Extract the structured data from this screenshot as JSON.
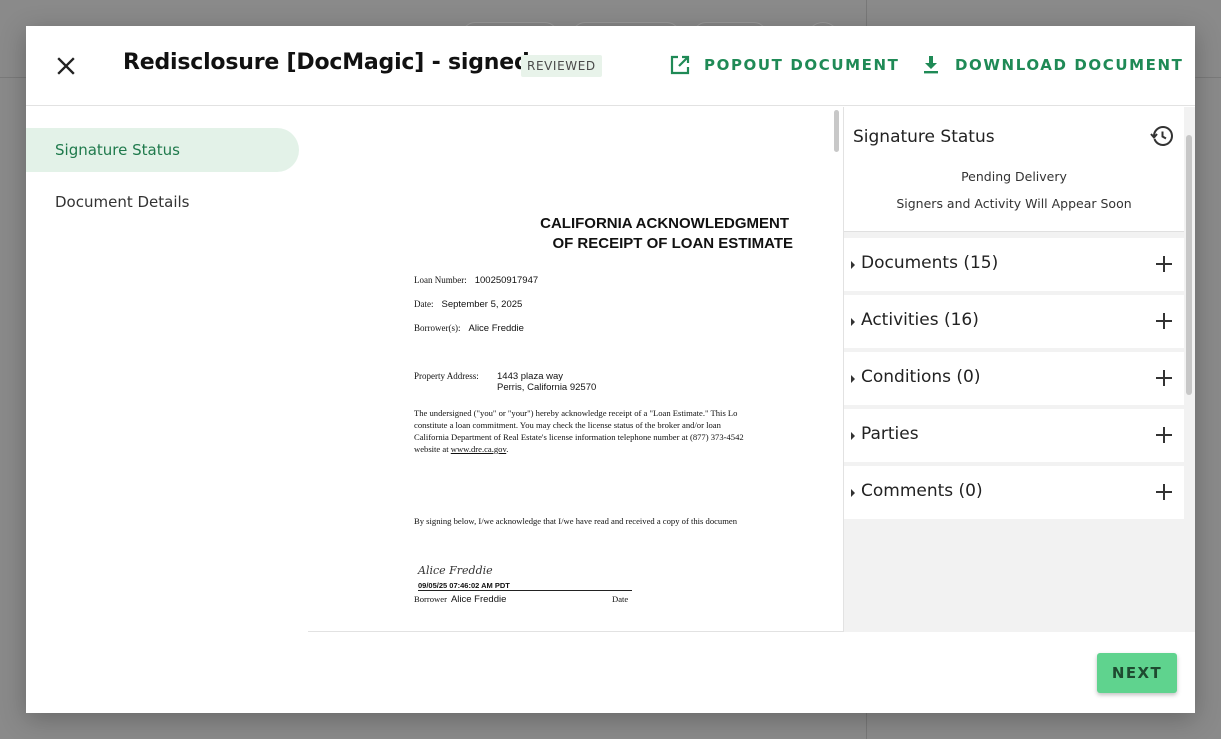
{
  "header": {
    "title": "Redisclosure [DocMagic] - signed",
    "badge": "REVIEWED",
    "popout_label": "POPOUT DOCUMENT",
    "download_label": "DOWNLOAD DOCUMENT",
    "icons": {
      "close": "close-icon",
      "popout": "open-in-new-icon",
      "download": "download-icon"
    }
  },
  "left_nav": {
    "items": [
      {
        "label": "Signature Status",
        "active": true
      },
      {
        "label": "Document Details",
        "active": false
      }
    ]
  },
  "document": {
    "title_line1": "CALIFORNIA ACKNOWLEDGMENT",
    "title_line2": "OF RECEIPT OF LOAN ESTIMATE",
    "loan_number_label": "Loan Number:",
    "loan_number": "100250917947",
    "date_label": "Date:",
    "date": "September 5, 2025",
    "borrowers_label": "Borrower(s):",
    "borrowers": "Alice Freddie",
    "property_label": "Property Address:",
    "property_line1": "1443 plaza way",
    "property_line2": "Perris, California 92570",
    "para_line1": "The undersigned (\"you\" or \"your\") hereby acknowledge receipt of a \"Loan Estimate.\" This Lo",
    "para_line2": "constitute a loan commitment.  You may check the license status of the broker and/or loan",
    "para_line3": "California Department of Real Estate's license information telephone number at (877) 373-4542",
    "para_line4_prefix": "website at ",
    "para_link": "www.dre.ca.gov",
    "para_line4_suffix": ".",
    "sign_para": "By signing below, I/we acknowledge that I/we have read and received a copy of this documen",
    "signature": "Alice Freddie",
    "signature_stamp": "09/05/25 07:46:02 AM PDT",
    "borrower_label": "Borrower",
    "borrower_name": "Alice Freddie",
    "date_col_label": "Date"
  },
  "right_panel": {
    "title": "Signature Status",
    "status_line1": "Pending Delivery",
    "status_line2": "Signers and Activity Will Appear Soon",
    "history_icon": "history-icon",
    "sections": [
      {
        "label": "Documents (15)"
      },
      {
        "label": "Activities (16)"
      },
      {
        "label": "Conditions (0)"
      },
      {
        "label": "Parties"
      },
      {
        "label": "Comments (0)"
      }
    ]
  },
  "footer": {
    "next_label": "NEXT"
  },
  "colors": {
    "accent": "#1f8a56",
    "active_nav_bg": "#e3f2e8",
    "next_button": "#5fd38e",
    "overlay": "#7f7f7f"
  }
}
